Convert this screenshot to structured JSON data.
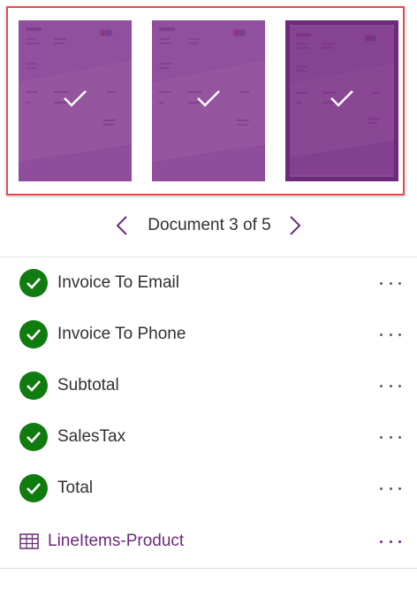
{
  "thumbnails": [
    {
      "icon": "checkmark-icon",
      "selected": false
    },
    {
      "icon": "checkmark-icon",
      "selected": false
    },
    {
      "icon": "checkmark-icon",
      "selected": true
    }
  ],
  "pager": {
    "label": "Document 3 of 5",
    "prev_icon": "chevron-left-icon",
    "next_icon": "chevron-right-icon"
  },
  "fields": [
    {
      "label": "Invoice To Email",
      "status": "success-check-icon"
    },
    {
      "label": "Invoice To Phone",
      "status": "success-check-icon"
    },
    {
      "label": "Subtotal",
      "status": "success-check-icon"
    },
    {
      "label": "SalesTax",
      "status": "success-check-icon"
    },
    {
      "label": "Total",
      "status": "success-check-icon"
    }
  ],
  "table_field": {
    "label": "LineItems-Product",
    "icon": "table-icon"
  },
  "colors": {
    "accent": "#6b2a7a",
    "success": "#107c10",
    "selection_border": "#e74c4c",
    "text": "#323130"
  }
}
